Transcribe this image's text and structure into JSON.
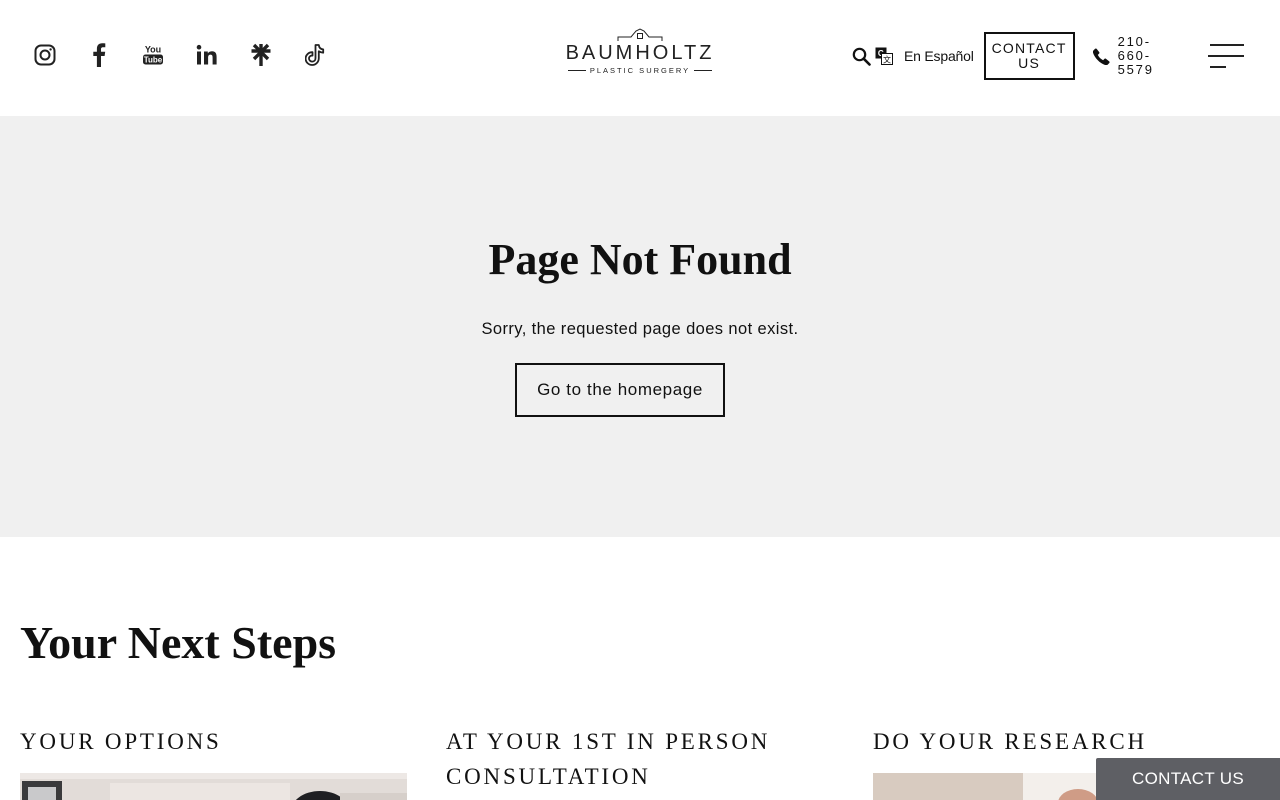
{
  "header": {
    "social": [
      "instagram-icon",
      "facebook-icon",
      "youtube-icon",
      "linkedin-icon",
      "linktree-icon",
      "tiktok-icon"
    ],
    "logo": {
      "name": "BAUMHOLTZ",
      "tagline": "PLASTIC SURGERY"
    },
    "language_link": "En Español",
    "contact_label": "CONTACT US",
    "phone": "210-660-5579"
  },
  "not_found": {
    "title": "Page Not Found",
    "message": "Sorry, the requested page does not exist.",
    "button": "Go to the homepage",
    "background": "#f0f0f0"
  },
  "next_steps": {
    "title": "Your Next Steps",
    "cards": [
      {
        "heading": "YOUR OPTIONS"
      },
      {
        "heading": "AT YOUR 1ST IN PERSON CONSULTATION"
      },
      {
        "heading": "DO YOUR RESEARCH"
      }
    ]
  },
  "floating_contact": {
    "label": "CONTACT US",
    "color": "#5e5f64"
  }
}
